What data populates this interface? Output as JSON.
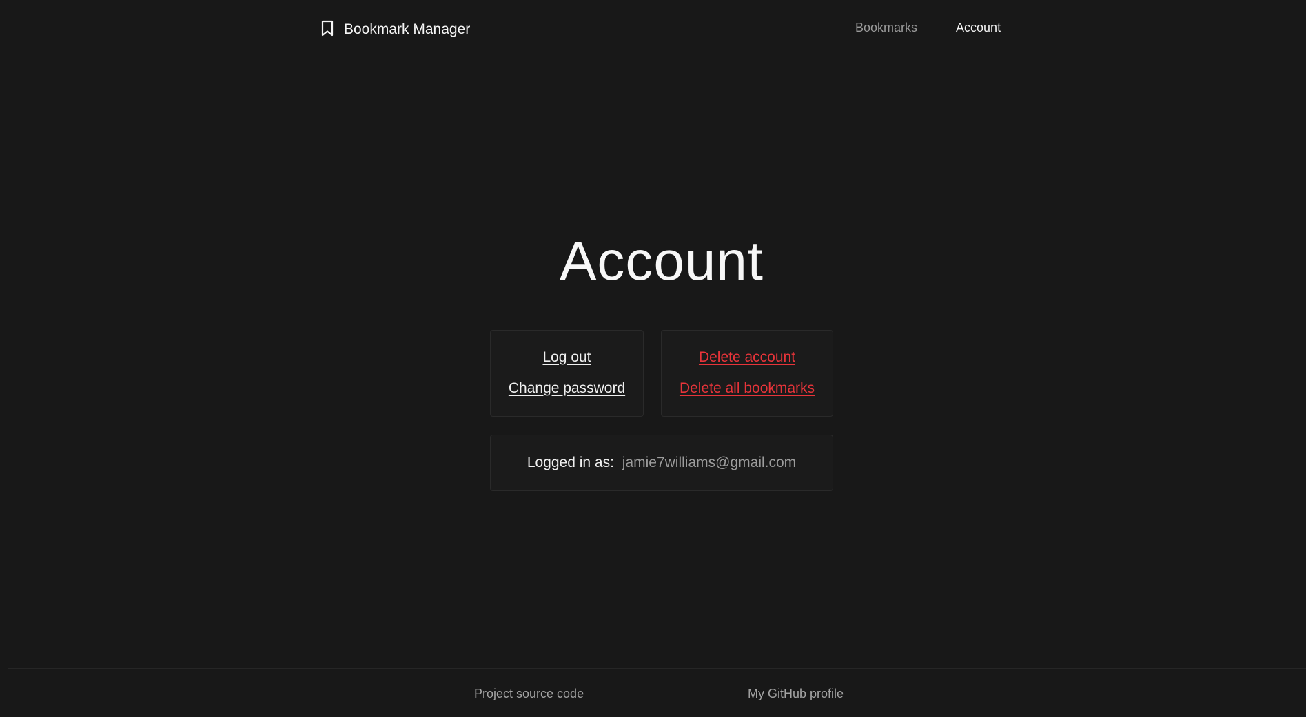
{
  "header": {
    "brand": {
      "name": "Bookmark Manager",
      "icon": "bookmark-icon"
    },
    "nav": [
      {
        "label": "Bookmarks",
        "active": false
      },
      {
        "label": "Account",
        "active": true
      }
    ]
  },
  "main": {
    "title": "Account",
    "session_actions": {
      "logout_label": "Log out",
      "change_password_label": "Change password"
    },
    "danger_actions": {
      "delete_account_label": "Delete account",
      "delete_bookmarks_label": "Delete all bookmarks"
    },
    "user_info": {
      "label": "Logged in as:",
      "email": "jamie7williams@gmail.com"
    }
  },
  "footer": {
    "links": [
      {
        "label": "Project source code"
      },
      {
        "label": "My GitHub profile"
      }
    ]
  },
  "colors": {
    "background": "#181818",
    "danger": "#e8343a",
    "muted": "#9a9a9a"
  }
}
